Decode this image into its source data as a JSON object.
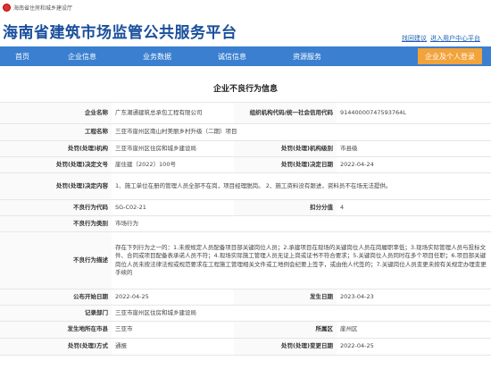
{
  "header": {
    "org_name": "海南省住房和城乡建设厅",
    "site_title": "海南省建筑市场监管公共服务平台",
    "links": [
      "找回建议",
      "进入用户中心平台"
    ]
  },
  "nav": {
    "items": [
      "首页",
      "企业信息",
      "业务数据",
      "诚信信息",
      "资源服务"
    ],
    "join_label": "企业及个人登录"
  },
  "section_title": "企业不良行为信息",
  "record": {
    "company_label": "企业名称",
    "company": "广东潮通建筑总承包工程有限公司",
    "credit_code_label": "组织机构代码/统一社会信用代码",
    "credit_code": "91440000747593764L",
    "project_label": "工程名称",
    "project": "三亚市崖州区南山村美丽乡村升级（二期）项目",
    "authority_label": "处罚(处理)机构",
    "authority": "三亚市崖州区住房和城乡建设局",
    "authority_level_label": "处罚(处理)机构级别",
    "authority_level": "市县级",
    "decision_no_label": "处罚(处理)决定文号",
    "decision_no": "崖住建〔2022〕100号",
    "decision_date_label": "处罚(处理)决定日期",
    "decision_date": "2022-04-24",
    "content_label": "处罚(处理)决定内容",
    "content": "1、施工单位在册的管理人员全部不在岗，项目经理脱岗。 2、施工资料没有跟进，资料员不在场无法提供。",
    "code_label": "不良行为代码",
    "code": "SG-C02-21",
    "points_label": "扣分分值",
    "points": "4",
    "category_label": "不良行为类别",
    "category": "市场行为",
    "description_label": "不良行为描述",
    "description": "存在下列行为之一的：1.未按规定人员配备项目部关键岗位人员；2.承建项目在现场的关键岗位人员在岗履职率低；3.现场实际管理人员与投标文件、合同或项目配备表承诺人员不符；4.现场实际施工管理人员无证上岗或证书不符合要求；5.关键岗位人员同时在多个项目任职；6.项目部关键岗位人员未按法律法规或规范要求在工程施工管理相关文件或工地例会纪要上签字，或由他人代签的；7.关键岗位人员变更未按有关规定办理变更手续的",
    "publish_start_label": "公布开始日期",
    "publish_start": "2022-04-25",
    "occur_date_label": "发生日期",
    "occur_date": "2023-04-23",
    "record_dept_label": "记录部门",
    "record_dept": "三亚市崖州区住房和城乡建设局",
    "city_label": "发生地所在市县",
    "city": "三亚市",
    "district_label": "所属区",
    "district": "崖州区",
    "notice_type_label": "处罚(处理)方式",
    "notice_type": "通报",
    "change_date_label": "处罚(处理)变更日期",
    "change_date": "2022-04-25"
  }
}
